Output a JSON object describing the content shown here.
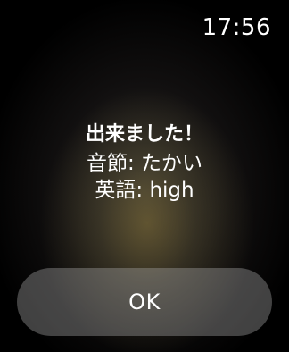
{
  "status_bar": {
    "time": "17:56"
  },
  "alert": {
    "title": "出来ました！",
    "syllable_line": "音節: たかい",
    "english_line": "英語: high"
  },
  "actions": {
    "ok_label": "OK"
  }
}
